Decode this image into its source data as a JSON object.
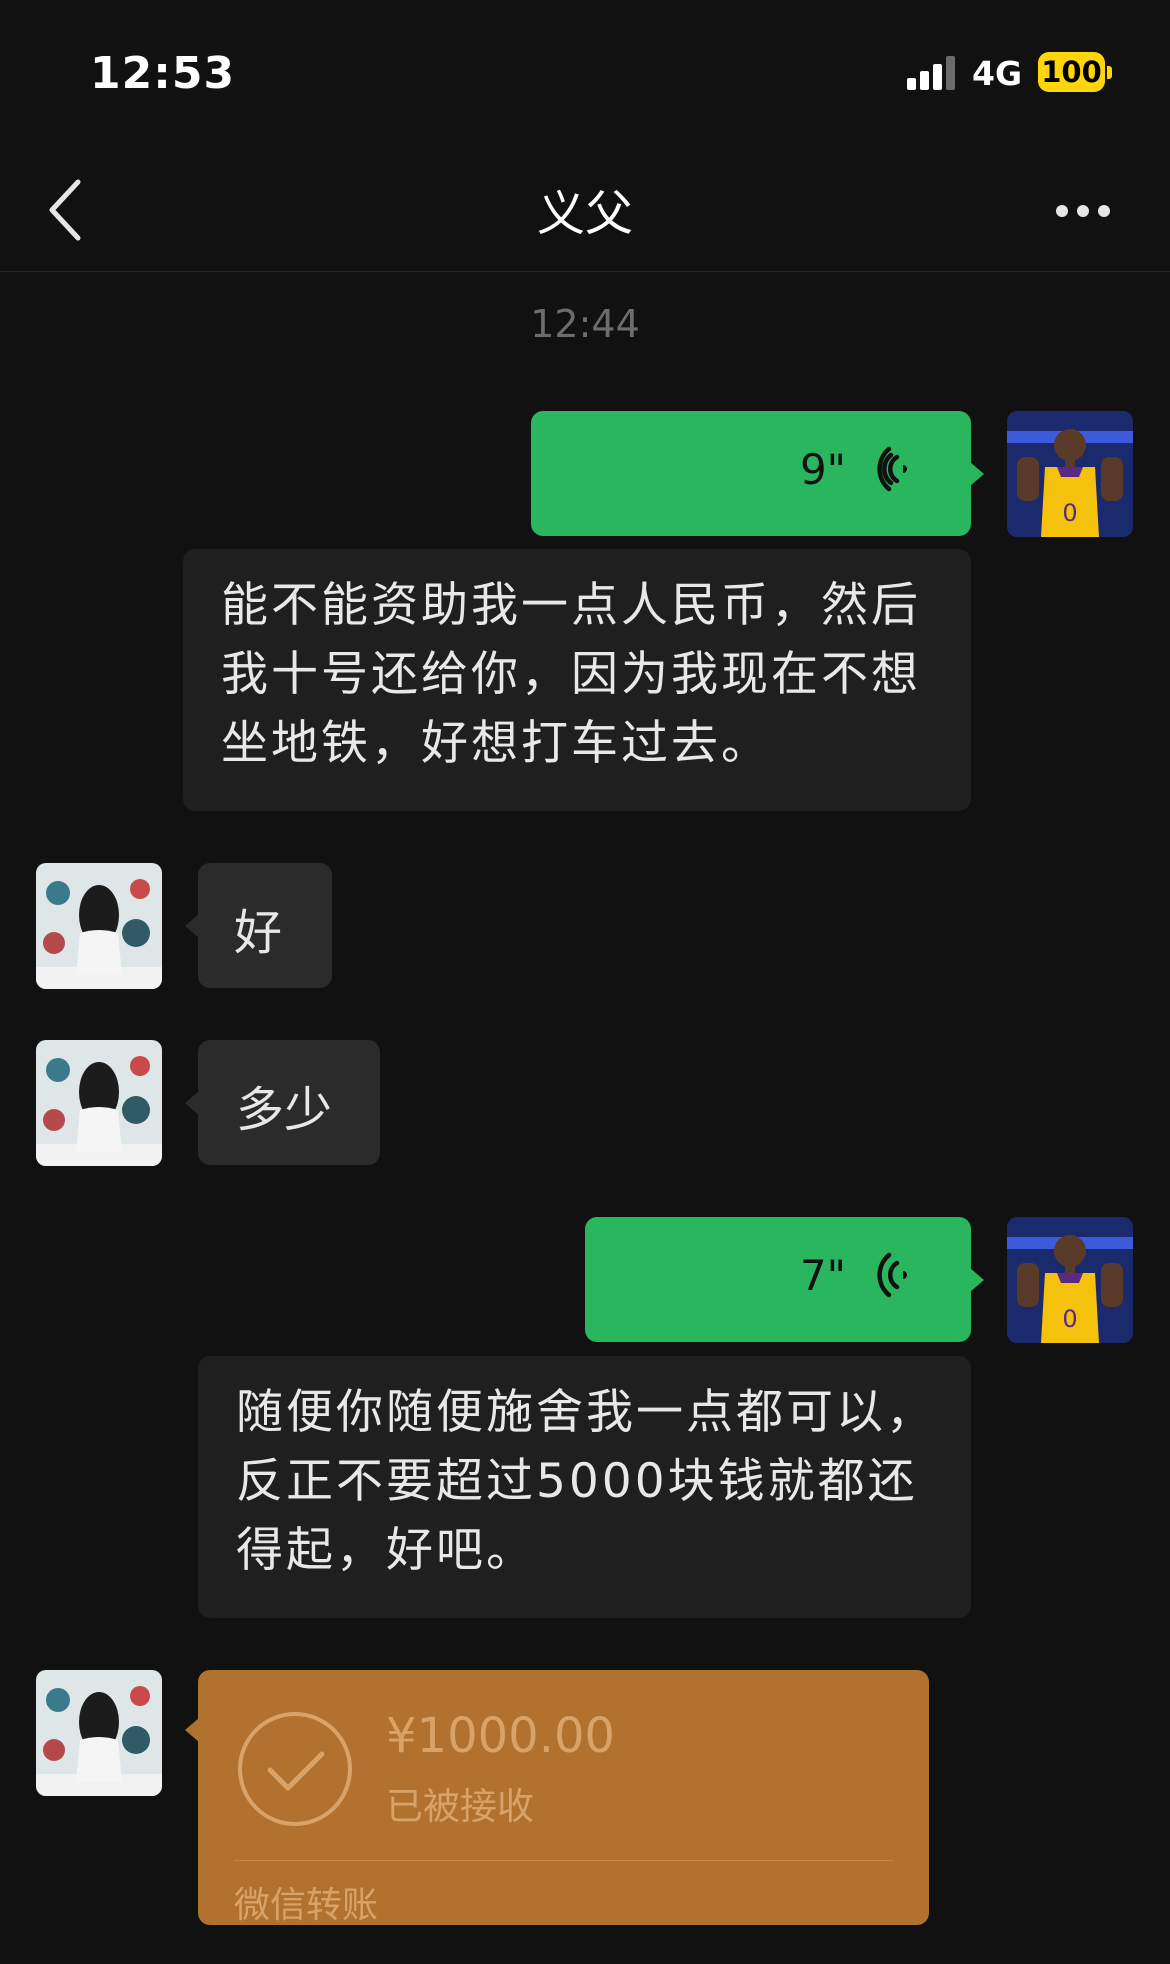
{
  "status_bar": {
    "time": "12:53",
    "network": "4G",
    "battery": "100"
  },
  "nav": {
    "title": "义父"
  },
  "chat": {
    "timestamp": "12:44",
    "messages": [
      {
        "type": "voice",
        "from": "me",
        "duration": "9\"",
        "transcript": "能不能资助我一点人民币，然后我十号还给你，因为我现在不想坐地铁，好想打车过去。"
      },
      {
        "type": "text",
        "from": "other",
        "text": "好"
      },
      {
        "type": "text",
        "from": "other",
        "text": "多少"
      },
      {
        "type": "voice",
        "from": "me",
        "duration": "7\"",
        "transcript": "随便你随便施舍我一点都可以，反正不要超过5000块钱就都还得起，好吧。"
      },
      {
        "type": "transfer",
        "from": "other",
        "amount": "¥1000.00",
        "status": "已被接收",
        "label": "微信转账"
      }
    ]
  },
  "colors": {
    "background": "#111111",
    "bubble_me": "#2ab55f",
    "bubble_other": "#2b2b2b",
    "transfer": "#b2722f"
  },
  "icons": {
    "back": "chevron-left-icon",
    "more": "ellipsis-icon",
    "voice": "voice-wave-icon",
    "check": "check-circle-icon"
  }
}
